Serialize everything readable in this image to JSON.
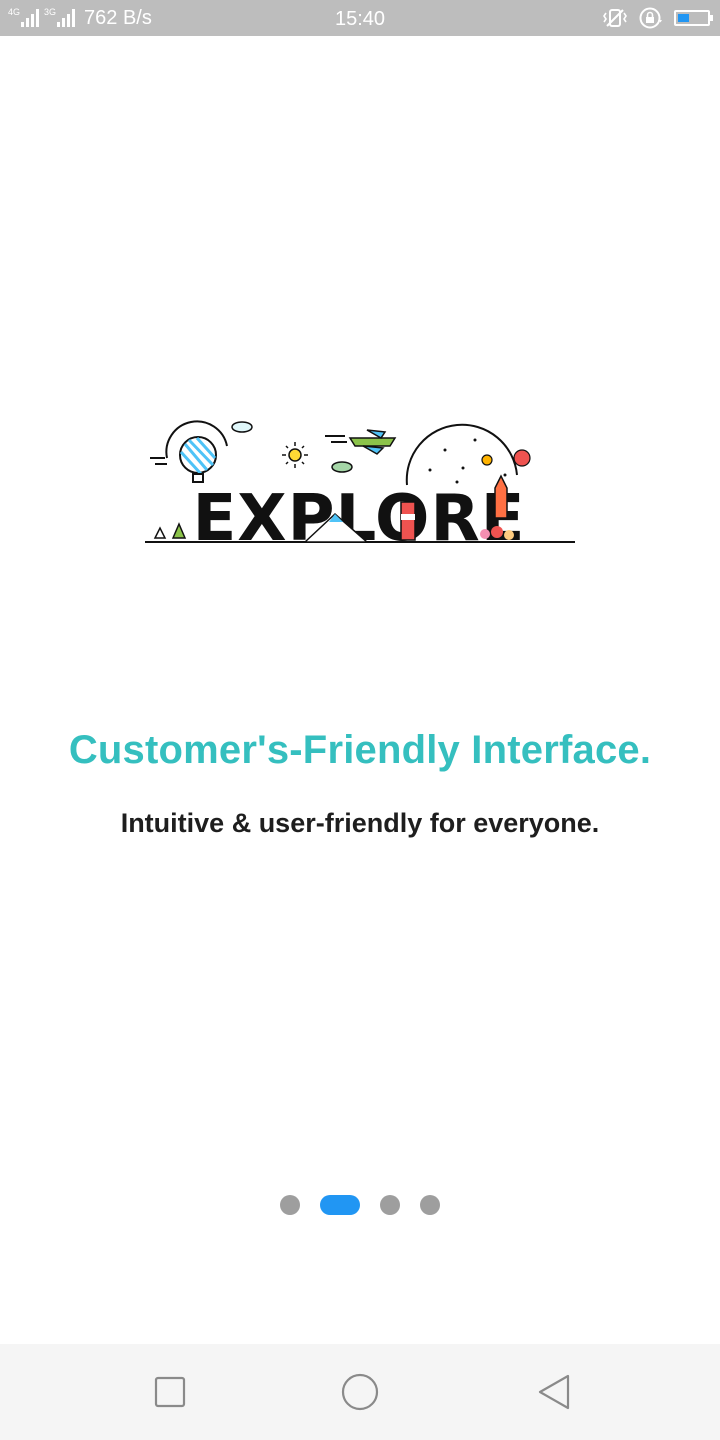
{
  "status_bar": {
    "network_tag_1": "4G",
    "network_tag_2": "3G",
    "net_speed": "762 B/s",
    "time": "15:40",
    "battery_level": 0.35,
    "battery_color": "#2196f3",
    "icons": [
      "signal-icon",
      "signal-icon",
      "vibrate-icon",
      "rotation-lock-icon",
      "battery-icon"
    ]
  },
  "onboarding": {
    "logo_word": "EXPLORE",
    "title": "Customer's-Friendly Interface.",
    "subtitle": "Intuitive & user-friendly for everyone.",
    "title_color": "#35bfbf",
    "page_count": 4,
    "current_page": 2,
    "active_dot_color": "#2196f3",
    "inactive_dot_color": "#9e9e9e"
  },
  "nav_bar": {
    "buttons": [
      "recents-icon",
      "home-icon",
      "back-icon"
    ]
  }
}
